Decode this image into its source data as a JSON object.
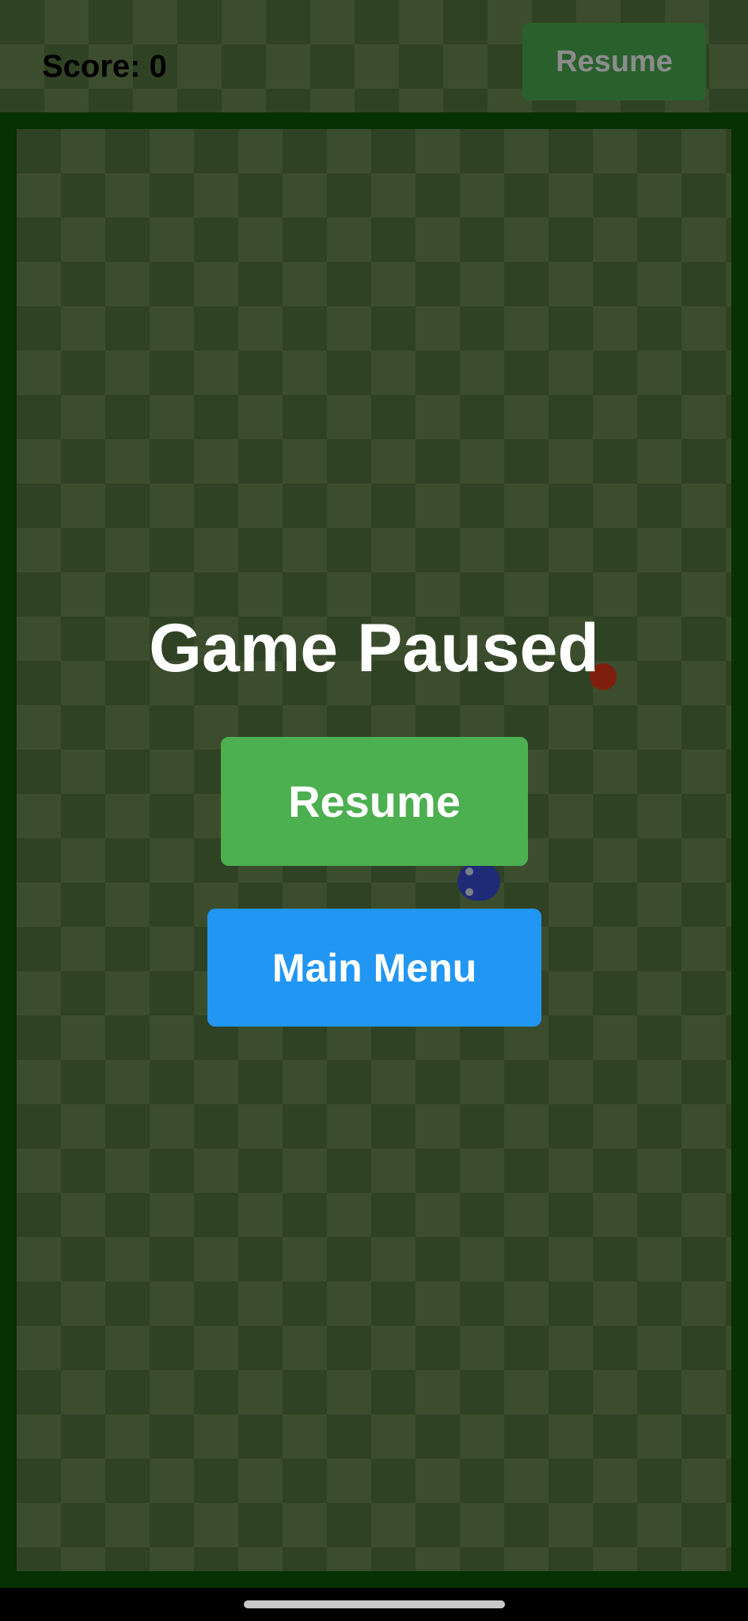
{
  "header": {
    "score_text": "Score: 0",
    "resume_label": "Resume"
  },
  "pause_menu": {
    "title": "Game Paused",
    "resume_label": "Resume",
    "main_menu_label": "Main Menu"
  },
  "colors": {
    "grass_light": "#6d8c53",
    "grass_dark": "#587842",
    "board_border": "#0b5a04",
    "food": "#e53919",
    "snake": "#3a4fd8",
    "resume_button": "#4caf50",
    "main_menu_button": "#2196f3"
  }
}
